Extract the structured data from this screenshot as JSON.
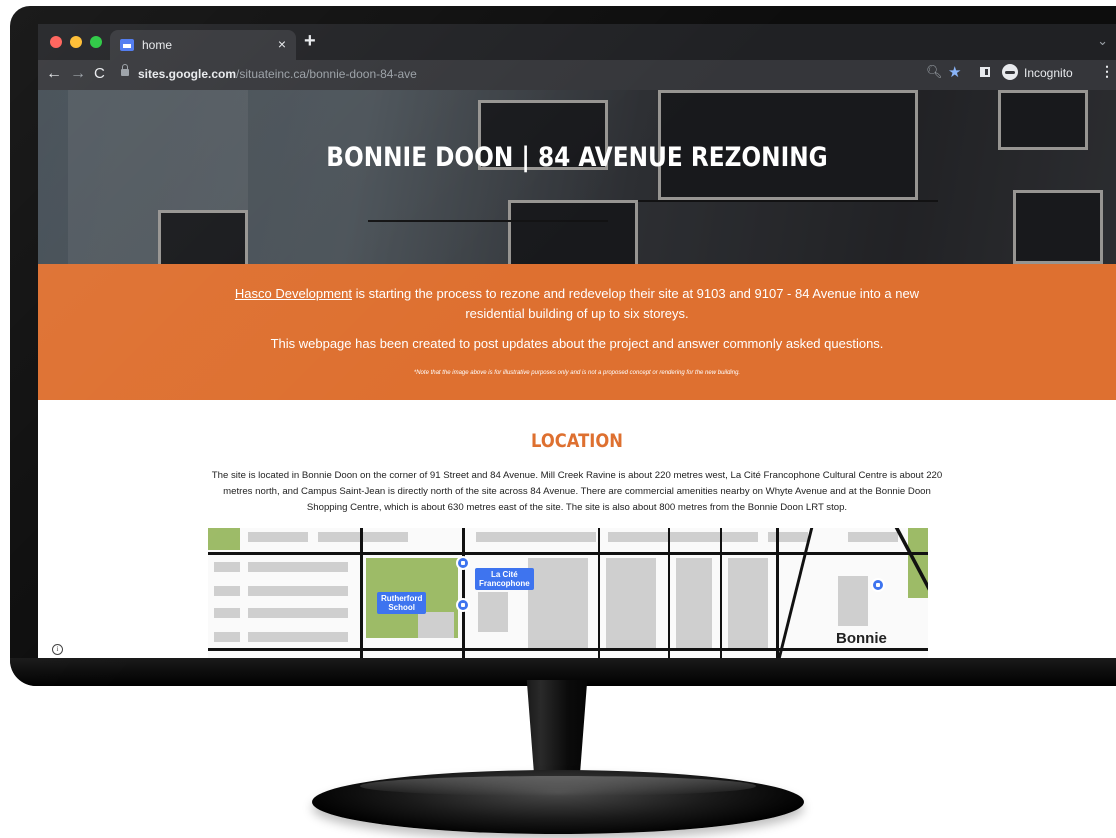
{
  "browser": {
    "tab_title": "home",
    "tab_close": "×",
    "new_tab": "+",
    "tab_menu": "⌄",
    "url_domain": "sites.google.com",
    "url_path": "/situateinc.ca/bonnie-doon-84-ave",
    "incognito_label": "Incognito",
    "back": "←",
    "forward": "→",
    "reload": "C",
    "zoom": "🔍︎",
    "star": "★",
    "menu": "⋮"
  },
  "hero": {
    "title": "BONNIE DOON | 84 AVENUE REZONING"
  },
  "intro": {
    "link_text": "Hasco Development",
    "p1_rest": " is starting the process to rezone and redevelop their site at 9103 and 9107 - 84 Avenue into a new residential building of up to six storeys.",
    "p2": "This webpage has been created to post updates about the project and answer commonly asked questions.",
    "note": "*Note that the image above is for illustrative purposes only and is not a proposed concept or rendering for the new building."
  },
  "location": {
    "title": "LOCATION",
    "text": "The site is located in Bonnie Doon on the corner of 91 Street and 84 Avenue. Mill Creek Ravine is about 220 metres west, La Cité Francophone Cultural Centre is about 220 metres north, and Campus Saint-Jean is directly north of the site across 84 Avenue. There are commercial amenities nearby on Whyte Avenue and at the Bonnie Doon Shopping Centre, which is about 630 metres east of the site. The site is also about 800 metres from the Bonnie Doon LRT stop."
  },
  "map": {
    "label_school_1": "Rutherford",
    "label_school_2": "School",
    "label_cite_1": "La Cité",
    "label_cite_2": "Francophone",
    "label_bonnie": "Bonnie"
  },
  "colors": {
    "accent": "#de7030",
    "map_label": "#3e74ef",
    "chrome": "#202124"
  }
}
